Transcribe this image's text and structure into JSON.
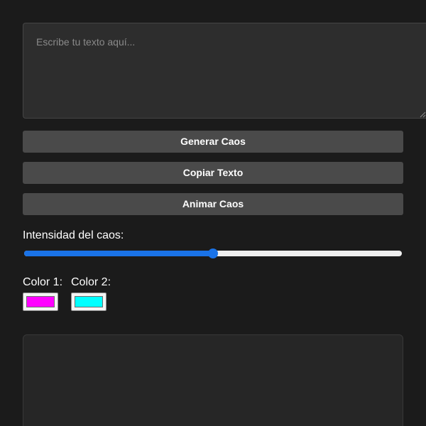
{
  "editor": {
    "placeholder": "Escribe tu texto aquí..."
  },
  "buttons": {
    "generate_label": "Generar Caos",
    "copy_label": "Copiar Texto",
    "animate_label": "Animar Caos"
  },
  "intensity": {
    "label": "Intensidad del caos:",
    "value": 0.5
  },
  "colors": {
    "color1_label": "Color 1:",
    "color1_value": "#ff00ff",
    "color2_label": "Color 2:",
    "color2_value": "#00ffff",
    "accent": "#1a73e8"
  }
}
